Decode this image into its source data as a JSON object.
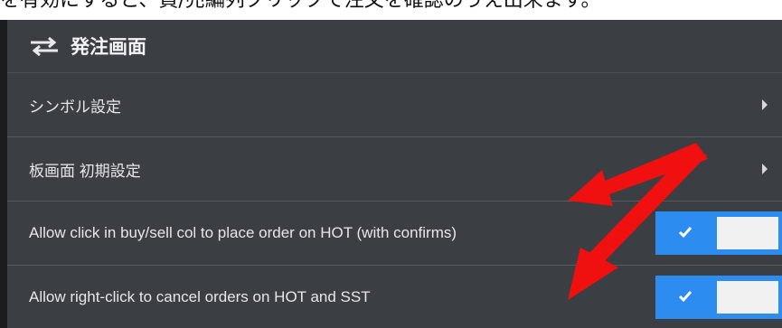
{
  "top_text": "を有効にすると、買/売編列クリックで注文を確認のうえ出来ます。",
  "panel": {
    "title": "発注画面",
    "rows": [
      {
        "label": "シンボル設定"
      },
      {
        "label": "板画面 初期設定"
      },
      {
        "label": "Allow click in buy/sell col to place order on HOT (with confirms)",
        "toggle_on": true
      },
      {
        "label": "Allow right-click to cancel orders on HOT and SST",
        "toggle_on": true
      }
    ]
  },
  "colors": {
    "panel_bg": "#3b3e43",
    "toggle_on": "#2d8cf0",
    "annotation_arrow": "#f01010"
  },
  "icons": {
    "header": "swap-arrows-icon",
    "submenu": "chevron-right-icon",
    "toggle": "check-icon"
  }
}
